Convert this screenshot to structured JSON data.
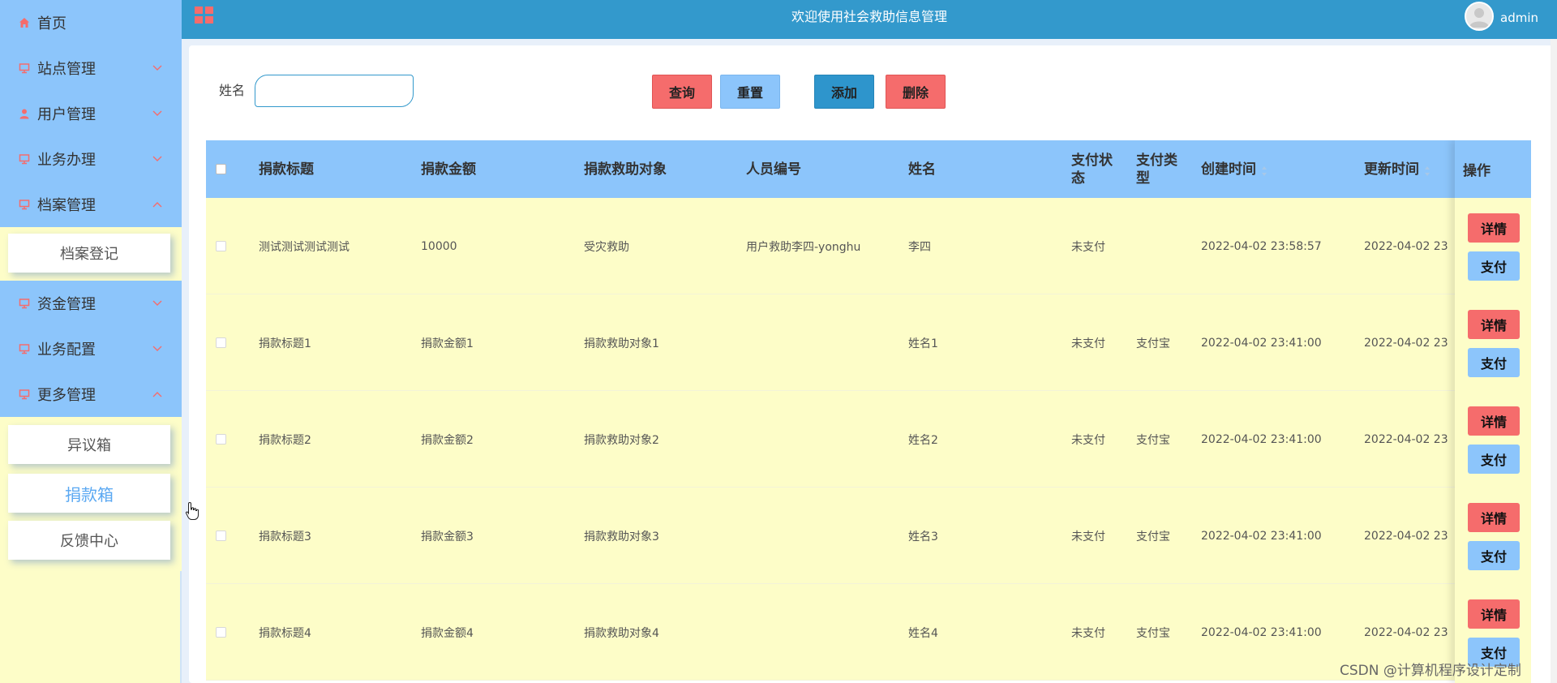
{
  "header": {
    "title": "欢迎使用社会救助信息管理",
    "username": "admin"
  },
  "sidebar": {
    "items": [
      {
        "label": "首页",
        "icon": "home-icon"
      },
      {
        "label": "站点管理",
        "icon": "monitor-icon"
      },
      {
        "label": "用户管理",
        "icon": "user-icon"
      },
      {
        "label": "业务办理",
        "icon": "monitor-icon"
      },
      {
        "label": "档案管理",
        "icon": "monitor-icon"
      },
      {
        "label": "资金管理",
        "icon": "monitor-icon"
      },
      {
        "label": "业务配置",
        "icon": "monitor-icon"
      },
      {
        "label": "更多管理",
        "icon": "monitor-icon"
      }
    ],
    "archive_sub": [
      "档案登记"
    ],
    "more_sub": [
      "异议箱",
      "捐款箱",
      "反馈中心"
    ],
    "active_sub": "捐款箱"
  },
  "filter": {
    "name_label": "姓名",
    "name_value": ""
  },
  "toolbar": {
    "search": "查询",
    "reset": "重置",
    "add": "添加",
    "delete": "删除"
  },
  "table": {
    "columns": [
      "捐款标题",
      "捐款金额",
      "捐款救助对象",
      "人员编号",
      "姓名",
      "支付状态",
      "支付类型",
      "创建时间",
      "更新时间"
    ],
    "ops_header": "操作",
    "detail_label": "详情",
    "pay_label": "支付",
    "rows": [
      {
        "title": "测试测试测试测试",
        "amount": "10000",
        "target": "受灾救助",
        "person_no": "用户救助李四-yonghu",
        "name": "李四",
        "pay_status": "未支付",
        "pay_type": "",
        "created": "2022-04-02 23:58:57",
        "updated": "2022-04-02 23"
      },
      {
        "title": "捐款标题1",
        "amount": "捐款金额1",
        "target": "捐款救助对象1",
        "person_no": "",
        "name": "姓名1",
        "pay_status": "未支付",
        "pay_type": "支付宝",
        "created": "2022-04-02 23:41:00",
        "updated": "2022-04-02 23"
      },
      {
        "title": "捐款标题2",
        "amount": "捐款金额2",
        "target": "捐款救助对象2",
        "person_no": "",
        "name": "姓名2",
        "pay_status": "未支付",
        "pay_type": "支付宝",
        "created": "2022-04-02 23:41:00",
        "updated": "2022-04-02 23"
      },
      {
        "title": "捐款标题3",
        "amount": "捐款金额3",
        "target": "捐款救助对象3",
        "person_no": "",
        "name": "姓名3",
        "pay_status": "未支付",
        "pay_type": "支付宝",
        "created": "2022-04-02 23:41:00",
        "updated": "2022-04-02 23"
      },
      {
        "title": "捐款标题4",
        "amount": "捐款金额4",
        "target": "捐款救助对象4",
        "person_no": "",
        "name": "姓名4",
        "pay_status": "未支付",
        "pay_type": "支付宝",
        "created": "2022-04-02 23:41:00",
        "updated": "2022-04-02 23"
      }
    ]
  },
  "watermark": "CSDN @计算机程序设计定制",
  "colors": {
    "header_bg": "#3399cc",
    "menu_bg": "#8cc5fb",
    "content_bg": "#fdfdc8",
    "danger": "#f56c6c",
    "primary": "#2e95cc",
    "icon_accent": "#f56c6c"
  }
}
